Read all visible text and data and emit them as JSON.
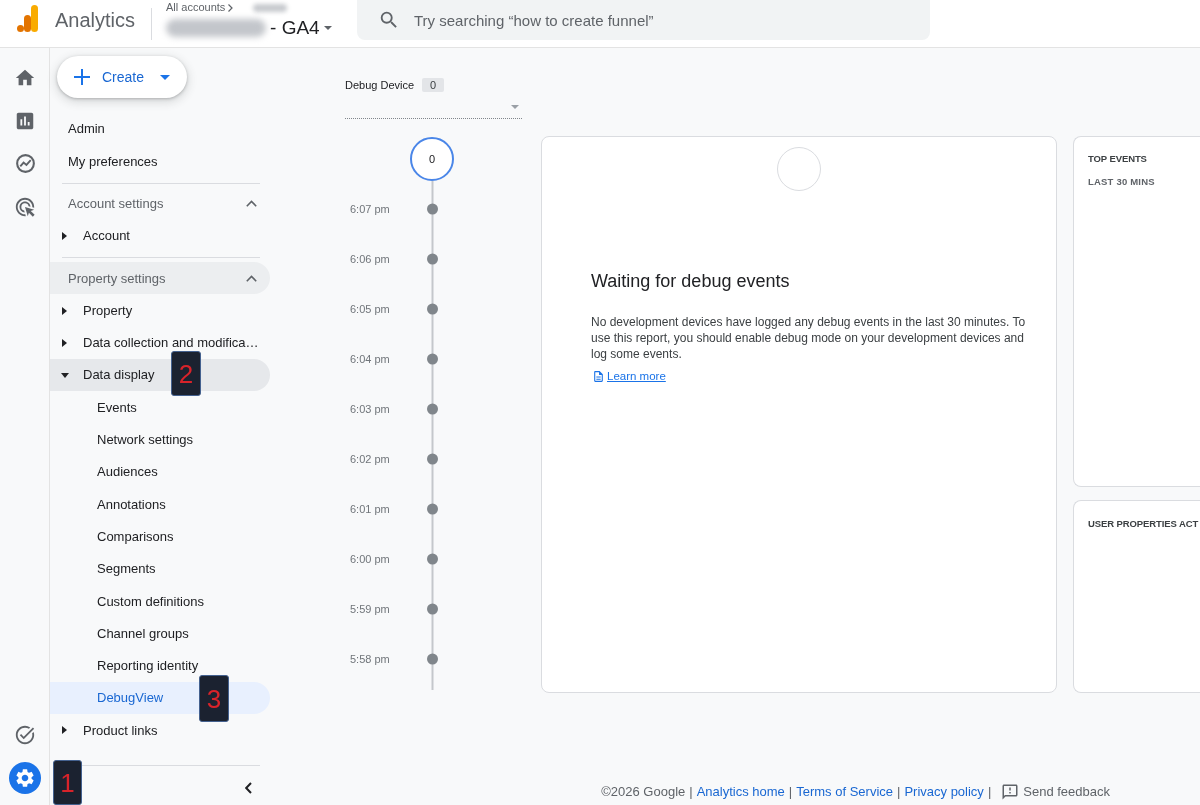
{
  "header": {
    "product": "Analytics",
    "breadcrumb": "All accounts",
    "property_suffix": "- GA4",
    "search": {
      "placeholder": "Try searching “how to create funnel”"
    }
  },
  "rail": {
    "top_items": [
      {
        "kind": "home",
        "selected": false
      },
      {
        "kind": "reports",
        "selected": false
      },
      {
        "kind": "explore",
        "selected": false
      },
      {
        "kind": "advertising",
        "selected": false
      }
    ],
    "bottom_items": [
      {
        "kind": "checklist",
        "selected": false
      },
      {
        "kind": "admin",
        "selected": true,
        "callout": "1"
      }
    ]
  },
  "sidebar": {
    "create_button": "Create",
    "links": [
      {
        "label": "Admin"
      },
      {
        "label": "My preferences"
      }
    ],
    "sections": [
      {
        "title": "Account settings",
        "expanded": true,
        "highlighted": false,
        "items": [
          {
            "label": "Account",
            "expanded": false,
            "highlighted": false
          }
        ]
      },
      {
        "title": "Property settings",
        "expanded": true,
        "highlighted": true,
        "items": [
          {
            "label": "Property",
            "expanded": false,
            "highlighted": false
          },
          {
            "label": "Data collection and modifica…",
            "expanded": false,
            "highlighted": false
          },
          {
            "label": "Data display",
            "expanded": true,
            "highlighted": true,
            "callout": "2",
            "children": [
              {
                "label": "Events",
                "selected": false
              },
              {
                "label": "Network settings",
                "selected": false
              },
              {
                "label": "Audiences",
                "selected": false
              },
              {
                "label": "Annotations",
                "selected": false
              },
              {
                "label": "Comparisons",
                "selected": false
              },
              {
                "label": "Segments",
                "selected": false
              },
              {
                "label": "Custom definitions",
                "selected": false
              },
              {
                "label": "Channel groups",
                "selected": false
              },
              {
                "label": "Reporting identity",
                "selected": false
              },
              {
                "label": "DebugView",
                "selected": true,
                "callout": "3"
              }
            ]
          },
          {
            "label": "Product links",
            "expanded": false,
            "highlighted": false
          }
        ]
      }
    ]
  },
  "debug_device": {
    "label": "Debug Device",
    "count": "0"
  },
  "timeline": {
    "current_count": "0",
    "times": [
      "6:07 pm",
      "6:06 pm",
      "6:05 pm",
      "6:04 pm",
      "6:03 pm",
      "6:02 pm",
      "6:01 pm",
      "6:00 pm",
      "5:59 pm",
      "5:58 pm"
    ]
  },
  "main_card": {
    "title": "Waiting for debug events",
    "body": "No development devices have logged any debug events in the last 30 minutes. To use this report, you should enable debug mode on your development devices and log some events.",
    "link": "Learn more"
  },
  "side_cards": [
    {
      "title": "TOP EVENTS",
      "subtitle": "LAST 30 MINS"
    },
    {
      "title": "USER PROPERTIES ACT"
    }
  ],
  "footer": [
    {
      "kind": "text",
      "label": "©2026 Google"
    },
    {
      "kind": "separator",
      "label": "|"
    },
    {
      "kind": "link",
      "label": "Analytics home"
    },
    {
      "kind": "separator",
      "label": "|"
    },
    {
      "kind": "link",
      "label": "Terms of Service"
    },
    {
      "kind": "separator",
      "label": "|"
    },
    {
      "kind": "link",
      "label": "Privacy policy"
    },
    {
      "kind": "separator",
      "label": "|"
    },
    {
      "kind": "feedback",
      "label": "Send feedback"
    }
  ]
}
